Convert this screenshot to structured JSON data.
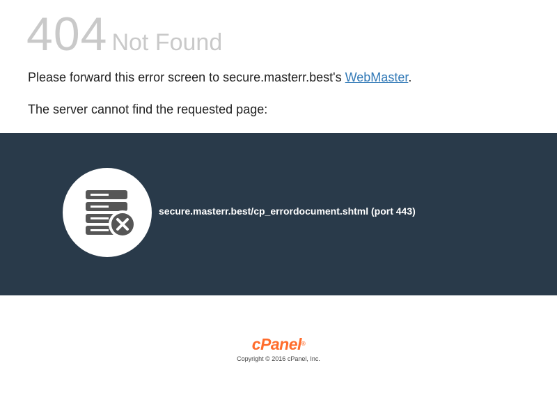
{
  "heading": {
    "code": "404",
    "text": "Not Found"
  },
  "message": {
    "line1_prefix": "Please forward this error screen to secure.masterr.best's ",
    "link_label": "WebMaster",
    "line1_suffix": ".",
    "line2": "The server cannot find the requested page:"
  },
  "banner": {
    "icon": "server-error-icon",
    "url": "secure.masterr.best/cp_errordocument.shtml (port 443)",
    "background": "#293a4a"
  },
  "footer": {
    "logo": "cPanel",
    "logo_mark": "®",
    "copyright": "Copyright © 2016 cPanel, Inc.",
    "logo_color": "#ff6c2c"
  }
}
